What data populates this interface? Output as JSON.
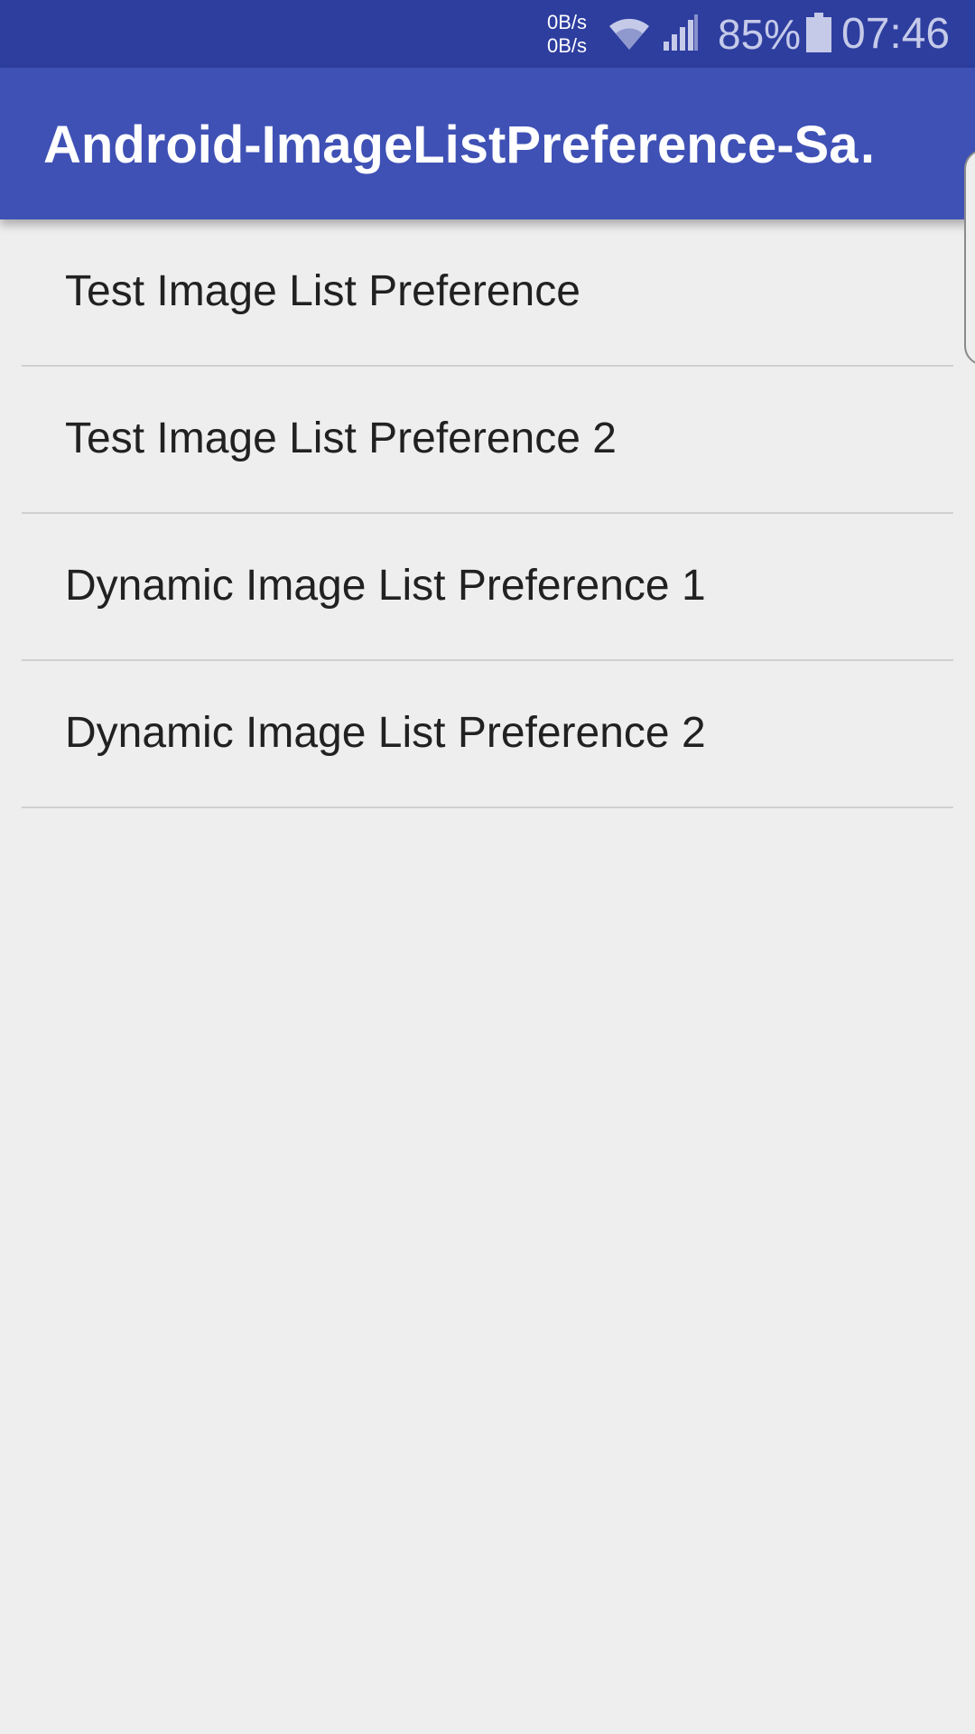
{
  "status_bar": {
    "net_up": "0B/s",
    "net_down": "0B/s",
    "wifi_icon": "wifi-icon",
    "signal_icon": "signal-icon",
    "battery_percent": "85%",
    "battery_icon": "battery-icon",
    "time": "07:46"
  },
  "app_bar": {
    "title": "Android-ImageListPreference-Sa…"
  },
  "preferences": [
    {
      "title": "Test Image List Preference"
    },
    {
      "title": "Test Image List Preference 2"
    },
    {
      "title": "Dynamic Image List Preference 1"
    },
    {
      "title": "Dynamic Image List Preference 2"
    }
  ],
  "colors": {
    "status_bar": "#2e3e9f",
    "app_bar": "#3f51b5",
    "background": "#eeeeee",
    "text_primary": "#212121",
    "divider": "#d0d0d0"
  }
}
